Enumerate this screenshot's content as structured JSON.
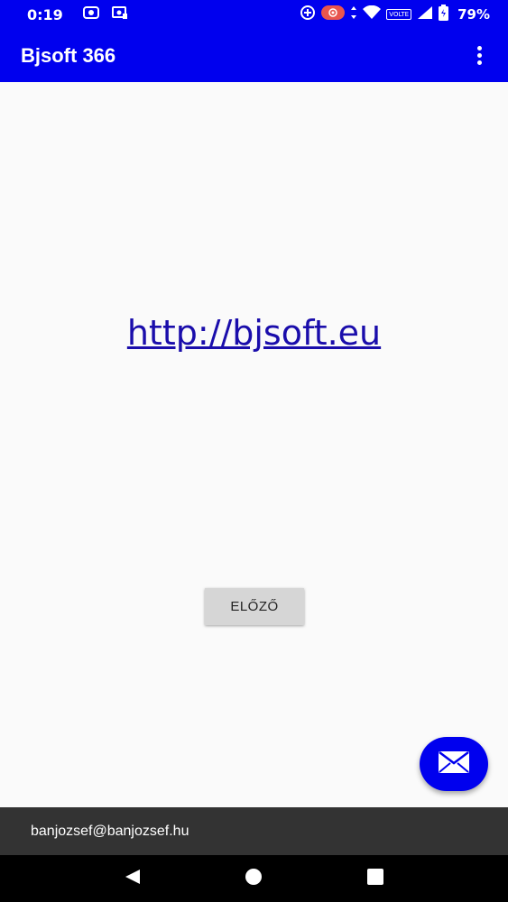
{
  "status_bar": {
    "time": "0:19",
    "battery": "79%",
    "volte": "VOLTE"
  },
  "app_bar": {
    "title": "Bjsoft 366"
  },
  "content": {
    "link_text": "http://bjsoft.eu",
    "prev_button_label": "ELŐZŐ"
  },
  "footer": {
    "email": "banjozsef@banjozsef.hu"
  },
  "colors": {
    "primary": "#0000ee",
    "link": "#1a0dab",
    "footer_bg": "#333333"
  }
}
